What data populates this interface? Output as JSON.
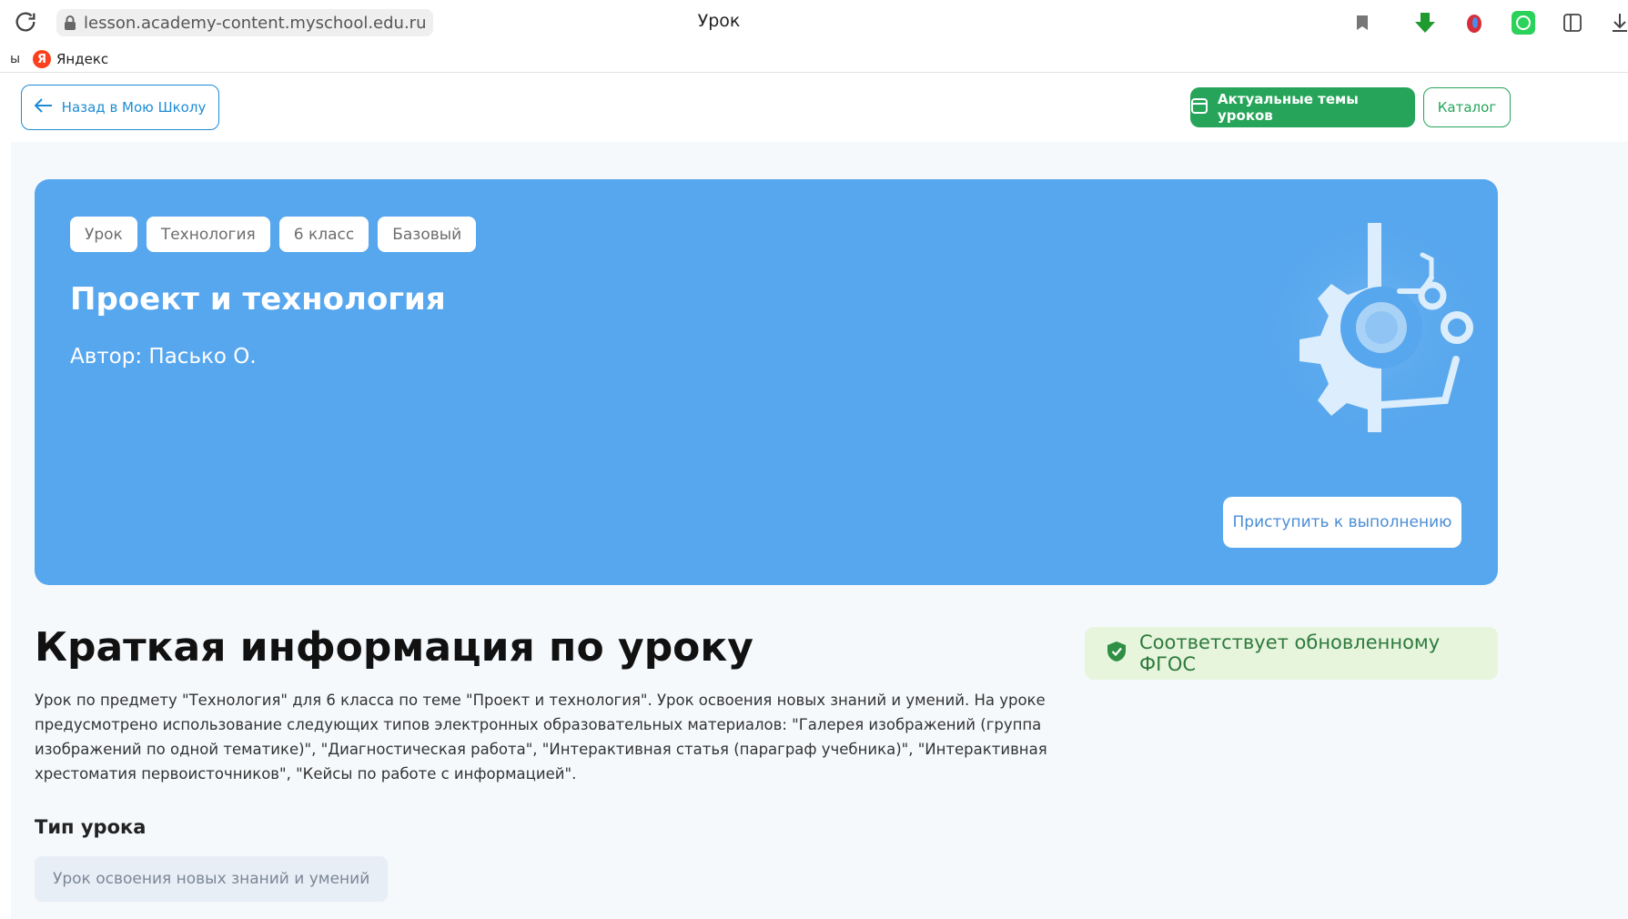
{
  "browser": {
    "url": "lesson.academy-content.myschool.edu.ru",
    "tab_title": "Урок",
    "bookmarks": {
      "left_fragment": "ы",
      "yandex_label": "Яндекс",
      "yandex_logo_letter": "Я"
    },
    "icons": [
      "reload-icon",
      "lock-icon",
      "bookmark-icon",
      "download-arrow-icon",
      "extension-icon",
      "whatsapp-icon",
      "sidebar-icon",
      "downloads-icon"
    ]
  },
  "header": {
    "back_label": "Назад в  Мою Школу",
    "topics_label": "Актуальные темы уроков",
    "catalog_label": "Каталог"
  },
  "hero": {
    "tags": [
      "Урок",
      "Технология",
      "6 класс",
      "Базовый"
    ],
    "title": "Проект и технология",
    "author": "Автор: Пасько О.",
    "start_label": "Приступить к выполнению",
    "illustration": "gear-circuit-icon"
  },
  "info": {
    "section_title": "Краткая информация по уроку",
    "fgos_label": "Соответствует обновленному ФГОС",
    "description": "Урок по предмету \"Технология\" для 6 класса по теме \"Проект и технология\". Урок освоения новых знаний и умений. На уроке предусмотрено использование следующих типов электронных образовательных материалов: \"Галерея изображений (группа изображений по одной тематике)\", \"Диагностическая работа\", \"Интерактивная статья (параграф учебника)\", \"Интерактивная хрестоматия первоисточников\", \"Кейсы по работе с информацией\".",
    "lesson_type_heading": "Тип урока",
    "lesson_type_value": "Урок освоения новых знаний и умений"
  },
  "colors": {
    "hero_bg": "#57a7ee",
    "primary_green": "#26a55a",
    "back_blue": "#1d8cd6",
    "fgos_bg": "#e6f5dc"
  }
}
